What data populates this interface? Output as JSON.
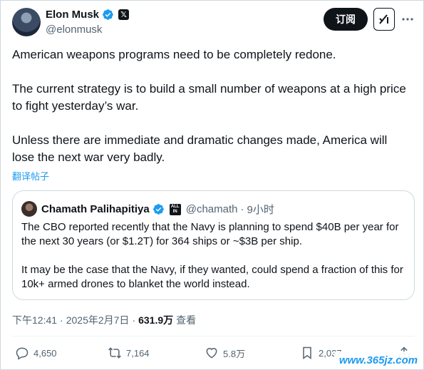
{
  "author": {
    "display_name": "Elon Musk",
    "handle": "@elonmusk",
    "affiliate_badge": "𝕏"
  },
  "header": {
    "subscribe_label": "订阅"
  },
  "tweet": {
    "paragraphs": [
      "American weapons programs need to be completely redone.",
      "The current strategy is to build a small number of weapons at a high price to fight yesterday’s war.",
      "Unless there are immediate and dramatic changes made, America will lose the next war very badly."
    ],
    "translate_label": "翻译帖子"
  },
  "quote": {
    "display_name": "Chamath Palihapitiya",
    "badge_text": "ALL IN",
    "handle": "@chamath",
    "separator": "·",
    "time": "9小时",
    "paragraphs": [
      "The CBO reported recently that the Navy is planning to spend $40B per year for the next 30 years (or $1.2T) for 364 ships or ~$3B per ship.",
      "It may be the case that the Navy, if they wanted, could spend a fraction of this for 10k+ armed drones to blanket the world instead."
    ]
  },
  "meta": {
    "time": "下午12:41",
    "separator1": "·",
    "date": "2025年2月7日",
    "separator2": "·",
    "views": "631.9万",
    "views_label": "查看"
  },
  "actions": {
    "replies": "4,650",
    "reposts": "7,164",
    "likes": "5.8万",
    "bookmarks": "2,037"
  },
  "watermark": "www.365jz.com",
  "colors": {
    "accent": "#1d9bf0",
    "text": "#0f1419",
    "secondary": "#536471",
    "border": "#cfd9de"
  }
}
